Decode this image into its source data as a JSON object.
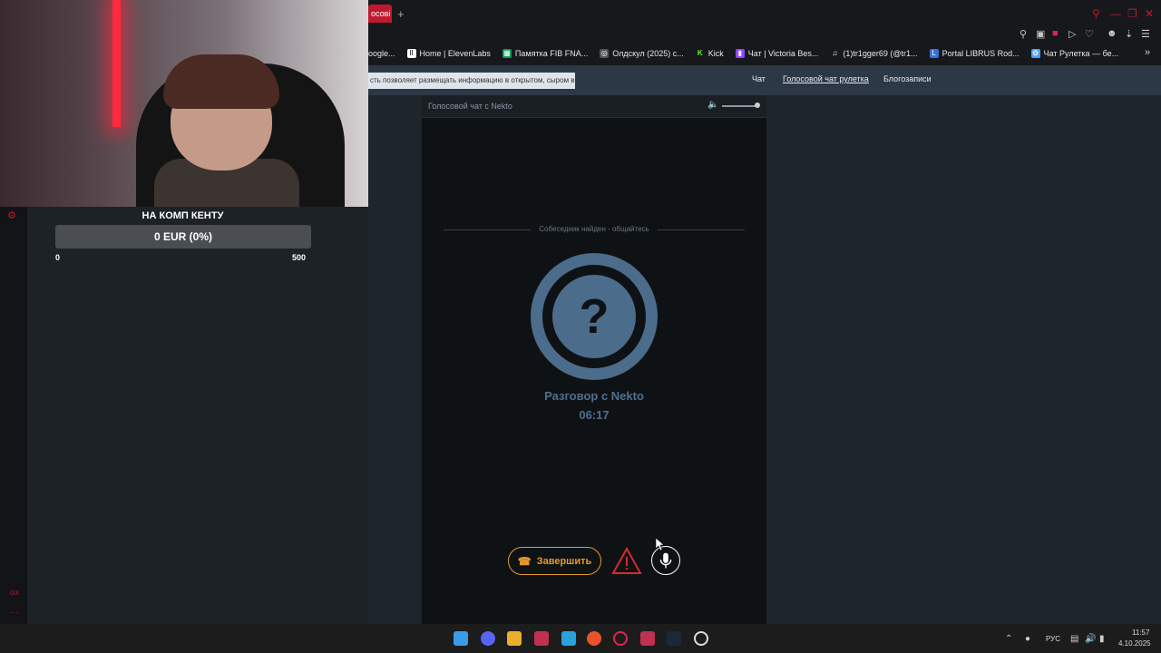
{
  "browser": {
    "active_tab_label": "осові",
    "new_tab_label": "+",
    "bookmarks": [
      {
        "label": "oogle...",
        "icon": "google-icon",
        "color": "#4285f4"
      },
      {
        "label": "Home | ElevenLabs",
        "icon": "elevenlabs-icon",
        "color": "#ffffff"
      },
      {
        "label": "Памятка FIB FNA...",
        "icon": "sheets-icon",
        "color": "#0f9d58"
      },
      {
        "label": "Олдскул (2025) с...",
        "icon": "film-icon",
        "color": "#cccccc"
      },
      {
        "label": "Kick",
        "icon": "kick-icon",
        "color": "#53fc18"
      },
      {
        "label": "Чат | Victoria Bes...",
        "icon": "twitch-icon",
        "color": "#9146ff"
      },
      {
        "label": "(1)tr1gger69 (@tr1...",
        "icon": "tiktok-icon",
        "color": "#ffffff"
      },
      {
        "label": "Portal LIBRUS Rod...",
        "icon": "librus-icon",
        "color": "#3b6fd6"
      },
      {
        "label": "Чат Рулетка — бе...",
        "icon": "roulette-icon",
        "color": "#4aa3ff"
      }
    ]
  },
  "stream_overlay": {
    "goal_title": "НА КОМП КЕНТУ",
    "goal_value": "0 EUR (0%)",
    "goal_min": "0",
    "goal_max": "500",
    "goal_progress": 0,
    "side_icons": [
      "gear-icon",
      "gx-label",
      "more-icon"
    ],
    "gx_label": "GX"
  },
  "site": {
    "banner_text": "сть позволяет размещать информацию в открытом, сыром виде!",
    "nav": {
      "chat": "Чат",
      "voice_roulette": "Голосовой чат рулетка",
      "blog": "Блогозаписи"
    }
  },
  "voice_chat": {
    "header_title": "Голосовой чат с Nekto",
    "found_text": "Собеседник найден - общайтесь",
    "avatar_symbol": "?",
    "conversation_label": "Разговор с Nekto",
    "timer": "06:17",
    "end_button": "Завершить",
    "accent": "#e39b2a",
    "avatar_color": "#4c6c8c"
  },
  "taskbar": {
    "lang": "РУС",
    "time": "11:57",
    "date": "4.10.2025"
  }
}
